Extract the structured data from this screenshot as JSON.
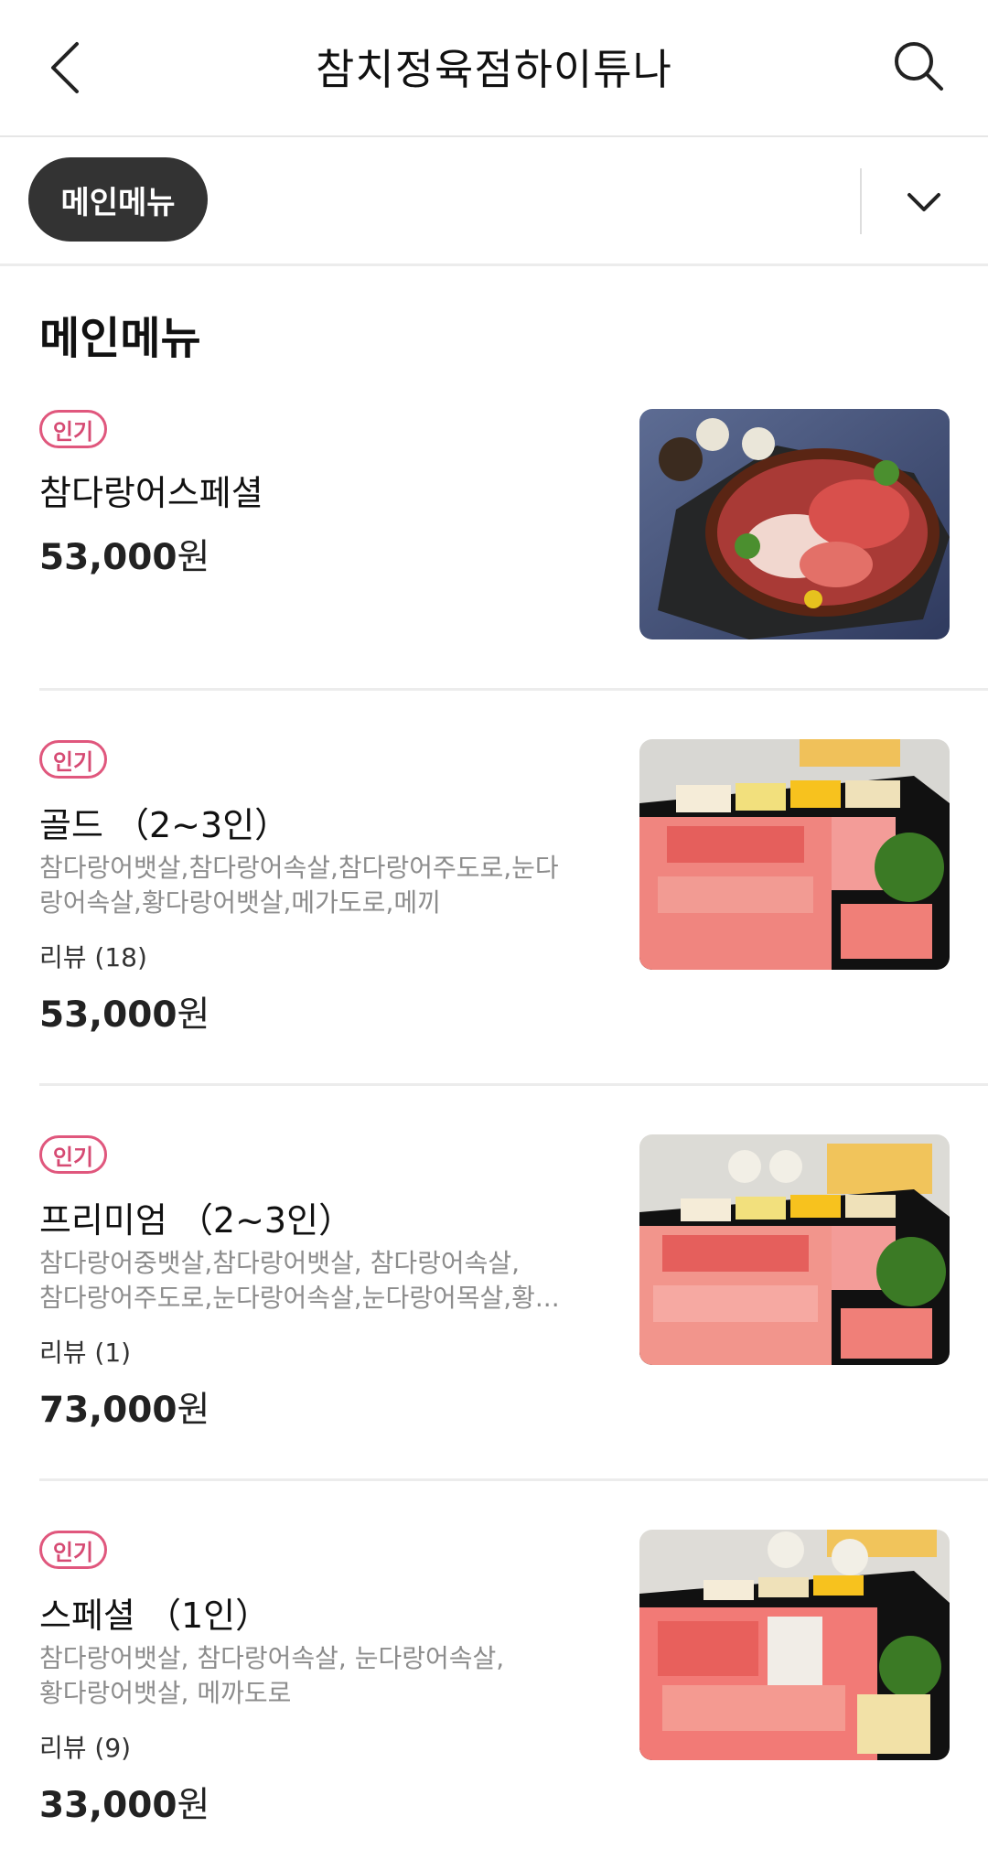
{
  "header": {
    "title": "참치정육점하이튜나",
    "back_icon": "chevron-left-icon",
    "search_icon": "search-icon"
  },
  "category_bar": {
    "selected": "메인메뉴",
    "expand_icon": "chevron-down-icon"
  },
  "section": {
    "title": "메인메뉴"
  },
  "menu_items": [
    {
      "badge": "인기",
      "name": "참다랑어스페셜",
      "description_line1": "",
      "description_line2": "",
      "review": "",
      "price_number": "53,000",
      "price_unit": "원",
      "thumbnail": "tuna-platter-photo"
    },
    {
      "badge": "인기",
      "name": "골드 （2~3인）",
      "description_line1": "참다랑어뱃살,참다랑어속살,참다랑어주도로,눈다",
      "description_line2": "랑어속살,황다랑어뱃살,메가도로,메끼",
      "review": "리뷰 (18)",
      "price_number": "53,000",
      "price_unit": "원",
      "thumbnail": "tuna-box-photo"
    },
    {
      "badge": "인기",
      "name": "프리미엄 （2~3인）",
      "description_line1": "참다랑어중뱃살,참다랑어뱃살, 참다랑어속살,",
      "description_line2": "참다랑어주도로,눈다랑어속살,눈다랑어목살,황...",
      "review": "리뷰 (1)",
      "price_number": "73,000",
      "price_unit": "원",
      "thumbnail": "tuna-box-photo"
    },
    {
      "badge": "인기",
      "name": "스페셜 （1인）",
      "description_line1": "참다랑어뱃살, 참다랑어속살, 눈다랑어속살,",
      "description_line2": "황다랑어뱃살, 메까도로",
      "review": "리뷰 (9)",
      "price_number": "33,000",
      "price_unit": "원",
      "thumbnail": "tuna-box-photo"
    }
  ],
  "colors": {
    "badge": "#e0577d",
    "pill_bg": "#333333",
    "desc_text": "#8c8c8c"
  }
}
